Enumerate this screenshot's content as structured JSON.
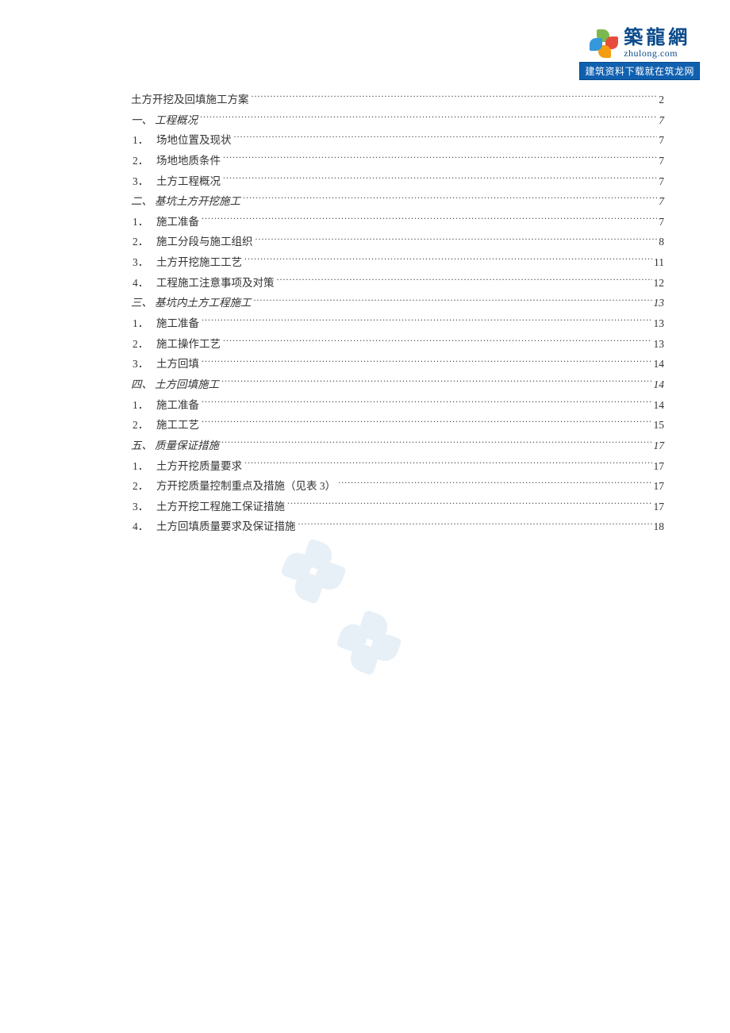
{
  "logo": {
    "brand_cn": "築龍網",
    "brand_en": "zhulong.com",
    "banner": "建筑资料下载就在筑龙网"
  },
  "toc": [
    {
      "level": 0,
      "marker": "",
      "title": "土方开挖及回填施工方案",
      "page": "2"
    },
    {
      "level": 1,
      "marker": "一、",
      "title": "工程概况",
      "page": "7"
    },
    {
      "level": 2,
      "marker": "1．",
      "title": "场地位置及现状",
      "page": "7"
    },
    {
      "level": 2,
      "marker": "2．",
      "title": "场地地质条件",
      "page": "7"
    },
    {
      "level": 2,
      "marker": "3．",
      "title": "土方工程概况",
      "page": "7"
    },
    {
      "level": 1,
      "marker": "二、",
      "title": "基坑土方开挖施工",
      "page": "7"
    },
    {
      "level": 2,
      "marker": "1．",
      "title": "施工准备",
      "page": "7"
    },
    {
      "level": 2,
      "marker": "2．",
      "title": "施工分段与施工组织",
      "page": "8"
    },
    {
      "level": 2,
      "marker": "3．",
      "title": "土方开挖施工工艺",
      "page": "11"
    },
    {
      "level": 2,
      "marker": "4．",
      "title": "工程施工注意事项及对策",
      "page": "12"
    },
    {
      "level": 1,
      "marker": "三、",
      "title": "基坑内土方工程施工",
      "page": "13"
    },
    {
      "level": 2,
      "marker": "1．",
      "title": "施工准备",
      "page": "13"
    },
    {
      "level": 2,
      "marker": "2．",
      "title": "施工操作工艺",
      "page": "13"
    },
    {
      "level": 2,
      "marker": "3．",
      "title": "土方回填",
      "page": "14"
    },
    {
      "level": 1,
      "marker": "四、",
      "title": "土方回填施工",
      "page": "14"
    },
    {
      "level": 2,
      "marker": "1．",
      "title": "施工准备",
      "page": "14"
    },
    {
      "level": 2,
      "marker": "2．",
      "title": "施工工艺",
      "page": "15"
    },
    {
      "level": 1,
      "marker": "五、",
      "title": "质量保证措施",
      "page": "17"
    },
    {
      "level": 2,
      "marker": "1．",
      "title": "土方开挖质量要求",
      "page": "17"
    },
    {
      "level": 2,
      "marker": "2．",
      "title": "方开挖质量控制重点及措施（见表 3）",
      "page": "17"
    },
    {
      "level": 2,
      "marker": "3．",
      "title": "土方开挖工程施工保证措施",
      "page": "17"
    },
    {
      "level": 2,
      "marker": "4．",
      "title": "土方回填质量要求及保证措施",
      "page": "18"
    }
  ]
}
